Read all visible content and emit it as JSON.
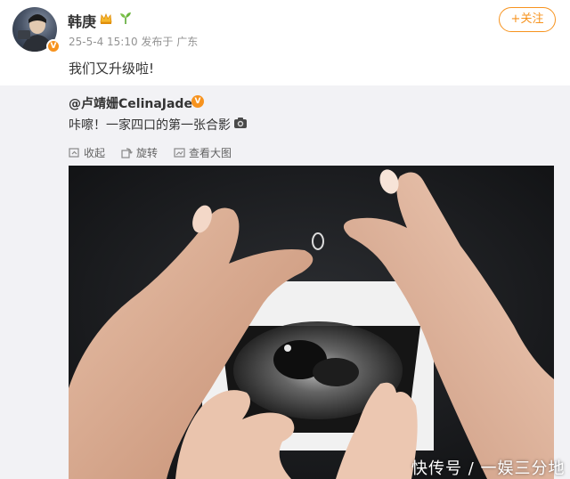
{
  "post": {
    "author": "韩庚",
    "meta": "25-5-4 15:10 发布于 广东",
    "follow_label": "+关注",
    "text": "我们又升级啦!",
    "verified_mark": "V"
  },
  "repost": {
    "author": "@卢靖姗CelinaJade",
    "verified_mark": "V",
    "text": "咔嚓！一家四口的第一张合影",
    "toolbar": {
      "collapse": "收起",
      "rotate": "旋转",
      "view_large": "查看大图"
    }
  },
  "watermark": "快传号 / 一娱三分地",
  "icons": [
    "crown-icon",
    "sprout-icon",
    "camera-icon",
    "collapse-icon",
    "rotate-icon",
    "view-large-icon"
  ],
  "colors": {
    "accent": "#f7931e",
    "meta_text": "#939393",
    "repost_bg": "#f2f2f5"
  }
}
